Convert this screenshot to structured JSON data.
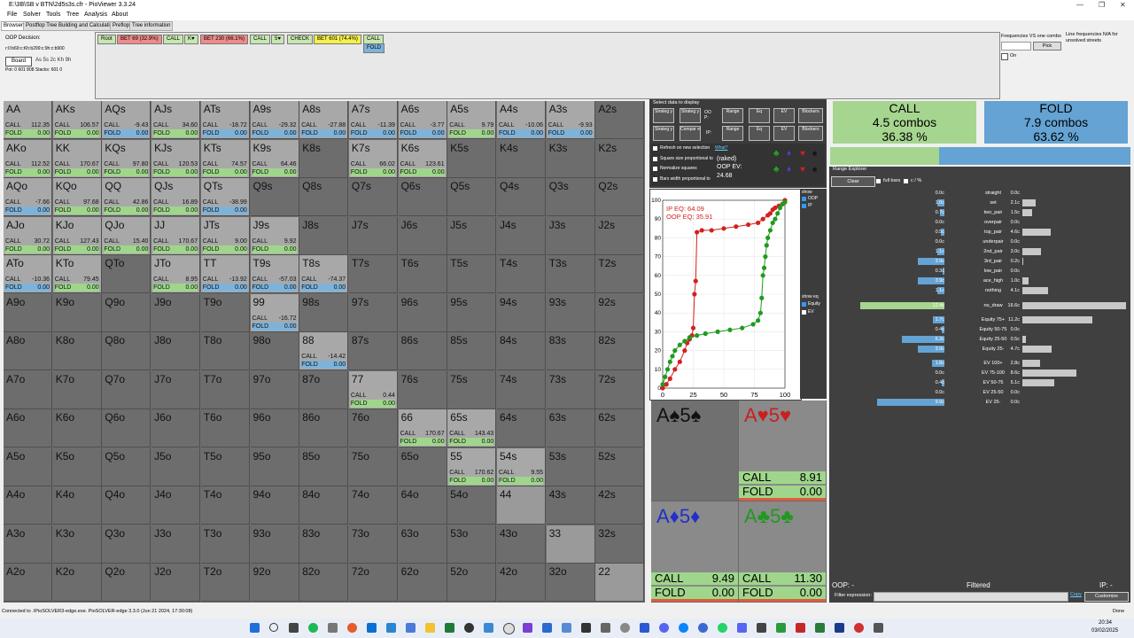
{
  "window": {
    "title": "E:\\3B\\SB v BTN\\2d5s3s.cfr - PioViewer 3.3.24",
    "controls": [
      "—",
      "❐",
      "✕"
    ]
  },
  "menu": [
    "File",
    "Solver",
    "Tools",
    "Tree",
    "Analysis",
    "About"
  ],
  "tabs": [
    "Browser",
    "Postflop Tree Building and Calculations",
    "Preflop",
    "Tree information"
  ],
  "oop_panel": {
    "title": "OOP Decision:",
    "path": "r:0:b69:c:Kh:b299:c:9h:c:b900",
    "board_btn": "Board",
    "board_cards": "As 5s 2c Kh 9h",
    "pot": "Pot: 0 601 808 Stacks: 601 0"
  },
  "tree_nodes": [
    {
      "label": "Root",
      "color": "#c7e7b0"
    },
    {
      "label": "BET 69 (32.9%)",
      "color": "#f08a8a"
    },
    {
      "label": "CALL",
      "color": "#c7e7b0"
    },
    {
      "label": "K♥",
      "color": "#c7e7b0"
    },
    {
      "label": "BET 230 (66.1%)",
      "color": "#f08a8a"
    },
    {
      "label": "CALL",
      "color": "#c7e7b0"
    },
    {
      "label": "5♥",
      "color": "#c7e7b0"
    },
    {
      "label": "CHECK",
      "color": "#c7e7b0"
    },
    {
      "label": "BET 601 (74.4%)",
      "color": "#f5f04a"
    },
    {
      "label": "CALL",
      "color": "#c7e7b0"
    }
  ],
  "tree_fold": "FOLD",
  "freq_panel": {
    "label": "Frequencies VS one combo",
    "pick": "Pick",
    "on": "On",
    "line_freq": "Line frequencies N/A for unsolved streets"
  },
  "grid": [
    [
      "AA",
      "AKs",
      "AQs",
      "AJs",
      "ATs",
      "A9s",
      "A8s",
      "A7s",
      "A6s",
      "A5s",
      "A4s",
      "A3s",
      "A2s"
    ],
    [
      "AKo",
      "KK",
      "KQs",
      "KJs",
      "KTs",
      "K9s",
      "K8s",
      "K7s",
      "K6s",
      "K5s",
      "K4s",
      "K3s",
      "K2s"
    ],
    [
      "AQo",
      "KQo",
      "QQ",
      "QJs",
      "QTs",
      "Q9s",
      "Q8s",
      "Q7s",
      "Q6s",
      "Q5s",
      "Q4s",
      "Q3s",
      "Q2s"
    ],
    [
      "AJo",
      "KJo",
      "QJo",
      "JJ",
      "JTs",
      "J9s",
      "J8s",
      "J7s",
      "J6s",
      "J5s",
      "J4s",
      "J3s",
      "J2s"
    ],
    [
      "ATo",
      "KTo",
      "QTo",
      "JTo",
      "TT",
      "T9s",
      "T8s",
      "T7s",
      "T6s",
      "T5s",
      "T4s",
      "T3s",
      "T2s"
    ],
    [
      "A9o",
      "K9o",
      "Q9o",
      "J9o",
      "T9o",
      "99",
      "98s",
      "97s",
      "96s",
      "95s",
      "94s",
      "93s",
      "92s"
    ],
    [
      "A8o",
      "K8o",
      "Q8o",
      "J8o",
      "T8o",
      "98o",
      "88",
      "87s",
      "86s",
      "85s",
      "84s",
      "83s",
      "82s"
    ],
    [
      "A7o",
      "K7o",
      "Q7o",
      "J7o",
      "T7o",
      "97o",
      "87o",
      "77",
      "76s",
      "75s",
      "74s",
      "73s",
      "72s"
    ],
    [
      "A6o",
      "K6o",
      "Q6o",
      "J6o",
      "T6o",
      "96o",
      "86o",
      "76o",
      "66",
      "65s",
      "64s",
      "63s",
      "62s"
    ],
    [
      "A5o",
      "K5o",
      "Q5o",
      "J5o",
      "T5o",
      "95o",
      "85o",
      "75o",
      "65o",
      "55",
      "54s",
      "53s",
      "52s"
    ],
    [
      "A4o",
      "K4o",
      "Q4o",
      "J4o",
      "T4o",
      "94o",
      "84o",
      "74o",
      "64o",
      "54o",
      "44",
      "43s",
      "42s"
    ],
    [
      "A3o",
      "K3o",
      "Q3o",
      "J3o",
      "T3o",
      "93o",
      "83o",
      "73o",
      "63o",
      "53o",
      "43o",
      "33",
      "32s"
    ],
    [
      "A2o",
      "K2o",
      "Q2o",
      "J2o",
      "T2o",
      "92o",
      "82o",
      "72o",
      "62o",
      "52o",
      "42o",
      "32o",
      "22"
    ]
  ],
  "strategies": {
    "AA": {
      "call": "112.35",
      "fold": "0.00"
    },
    "AKs": {
      "call": "106.57",
      "fold": "0.00"
    },
    "AQs": {
      "call": "-9.43",
      "fold": "0.00"
    },
    "AJs": {
      "call": "34.60",
      "fold": "0.00"
    },
    "ATs": {
      "call": "-18.72",
      "fold": "0.00"
    },
    "A9s": {
      "call": "-29.32",
      "fold": "0.00"
    },
    "A8s": {
      "call": "-27.88",
      "fold": "0.00"
    },
    "A7s": {
      "call": "-11.39",
      "fold": "0.00"
    },
    "A6s": {
      "call": "-3.77",
      "fold": "0.00"
    },
    "A5s": {
      "call": "9.79",
      "fold": "0.00"
    },
    "A4s": {
      "call": "-10.06",
      "fold": "0.00"
    },
    "A3s": {
      "call": "-9.93",
      "fold": "0.00"
    },
    "AKo": {
      "call": "112.52",
      "fold": "0.00"
    },
    "KK": {
      "call": "170.67",
      "fold": "0.00"
    },
    "KQs": {
      "call": "97.80",
      "fold": "0.00"
    },
    "KJs": {
      "call": "120.53",
      "fold": "0.00"
    },
    "KTs": {
      "call": "74.57",
      "fold": "0.00"
    },
    "K9s": {
      "call": "64.46",
      "fold": "0.00"
    },
    "K7s": {
      "call": "66.02",
      "fold": "0.00"
    },
    "K6s": {
      "call": "123.61",
      "fold": "0.00"
    },
    "AQo": {
      "call": "-7.66",
      "fold": "0.00"
    },
    "KQo": {
      "call": "97.68",
      "fold": "0.00"
    },
    "QQ": {
      "call": "42.86",
      "fold": "0.00"
    },
    "QJs": {
      "call": "16.89",
      "fold": "0.00"
    },
    "QTs": {
      "call": "-38.99",
      "fold": "0.00"
    },
    "AJo": {
      "call": "30.72",
      "fold": "0.00"
    },
    "KJo": {
      "call": "127.43",
      "fold": "0.00"
    },
    "QJo": {
      "call": "15.40",
      "fold": "0.00"
    },
    "JJ": {
      "call": "170.67",
      "fold": "0.00"
    },
    "JTs": {
      "call": "9.00",
      "fold": "0.00"
    },
    "J9s": {
      "call": "9.92",
      "fold": "0.00"
    },
    "ATo": {
      "call": "-10.36",
      "fold": "0.00"
    },
    "KTo": {
      "call": "79.45",
      "fold": "0.00"
    },
    "JTo": {
      "call": "8.95",
      "fold": "0.00"
    },
    "TT": {
      "call": "-13.92",
      "fold": "0.00"
    },
    "T9s": {
      "call": "-57.03",
      "fold": "0.00"
    },
    "T8s": {
      "call": "-74.37",
      "fold": "0.00"
    },
    "99": {
      "call": "-16.72",
      "fold": "0.00"
    },
    "88": {
      "call": "-14.42",
      "fold": "0.00"
    },
    "77": {
      "call": "0.44",
      "fold": "0.00"
    },
    "66": {
      "call": "170.67",
      "fold": "0.00"
    },
    "65s": {
      "call": "143.43",
      "fold": "0.00"
    },
    "55": {
      "call": "170.62",
      "fold": "0.00"
    },
    "54s": {
      "call": "9.55",
      "fold": "0.00"
    }
  },
  "call_fold_text": {
    "call": "CALL",
    "fold": "FOLD"
  },
  "data_panel": {
    "title": "Select data to display",
    "oop_buttons": [
      "Strateg y",
      "Strateg y",
      "Range",
      "Eq",
      "EV",
      "Blockers"
    ],
    "ip_buttons": [
      "Strateg y",
      "Compar e",
      "Range",
      "Eq",
      "EV",
      "Blockers"
    ],
    "oop_label": "OO P:",
    "ip_label": "IP:",
    "checks": [
      "Refresh on new selection",
      "Square size proportional to",
      "Normalize squares",
      "Bars width proportional to"
    ],
    "what": "What?",
    "raked": "(raked)",
    "oop_ev_label": "OOP EV:",
    "oop_ev_value": "24.68"
  },
  "chart_data": {
    "type": "line",
    "annotations": {
      "ip": "IP EQ: 64.09",
      "oop": "OOP EQ: 35.91"
    },
    "xlim": [
      0,
      100
    ],
    "ylim": [
      0,
      100
    ],
    "x_ticks": [
      0,
      25,
      50,
      75,
      100
    ],
    "y_ticks": [
      0,
      10,
      20,
      30,
      40,
      50,
      60,
      70,
      80,
      90,
      100
    ],
    "series": [
      {
        "color": "#d42020",
        "points": [
          [
            0,
            0
          ],
          [
            3,
            2
          ],
          [
            6,
            5
          ],
          [
            10,
            10
          ],
          [
            14,
            14
          ],
          [
            18,
            20
          ],
          [
            20,
            24
          ],
          [
            22,
            26
          ],
          [
            24,
            28
          ],
          [
            25,
            32
          ],
          [
            26,
            50
          ],
          [
            27,
            57
          ],
          [
            28,
            83
          ],
          [
            32,
            84
          ],
          [
            40,
            84
          ],
          [
            50,
            85
          ],
          [
            60,
            86
          ],
          [
            70,
            87
          ],
          [
            78,
            88
          ],
          [
            82,
            90
          ],
          [
            86,
            92
          ],
          [
            88,
            93
          ],
          [
            90,
            95
          ],
          [
            92,
            96
          ],
          [
            95,
            97
          ],
          [
            98,
            98
          ],
          [
            100,
            100
          ]
        ]
      },
      {
        "color": "#1f9a1f",
        "points": [
          [
            0,
            2
          ],
          [
            2,
            6
          ],
          [
            4,
            10
          ],
          [
            6,
            14
          ],
          [
            8,
            17
          ],
          [
            10,
            20
          ],
          [
            14,
            23
          ],
          [
            18,
            25
          ],
          [
            22,
            27
          ],
          [
            28,
            28
          ],
          [
            35,
            29
          ],
          [
            45,
            30
          ],
          [
            55,
            31
          ],
          [
            65,
            32
          ],
          [
            74,
            34
          ],
          [
            78,
            36
          ],
          [
            80,
            40
          ],
          [
            81,
            48
          ],
          [
            82,
            60
          ],
          [
            83,
            64
          ],
          [
            84,
            70
          ],
          [
            85,
            76
          ],
          [
            86,
            80
          ],
          [
            88,
            84
          ],
          [
            90,
            88
          ],
          [
            92,
            90
          ],
          [
            94,
            93
          ],
          [
            96,
            96
          ],
          [
            98,
            98
          ],
          [
            100,
            99
          ]
        ]
      }
    ]
  },
  "chart_side": {
    "show": "show",
    "oop": "OOP",
    "ip": "IP",
    "show_eq": "show eq",
    "equity": "Equity",
    "ev": "EV"
  },
  "suits": [
    {
      "cards": "A♠5♠",
      "color": "#111111",
      "call": "",
      "fold": ""
    },
    {
      "cards": "A♥5♥",
      "color": "#c82020",
      "call": "8.91",
      "fold": "0.00"
    },
    {
      "cards": "A♦5♦",
      "color": "#2030c8",
      "call": "9.49",
      "fold": "0.00"
    },
    {
      "cards": "A♣5♣",
      "color": "#1f9a1f",
      "call": "11.30",
      "fold": "0.00"
    }
  ],
  "summary": {
    "call": {
      "label": "CALL",
      "combos": "4.5 combos",
      "pct": "36.38 %"
    },
    "fold": {
      "label": "FOLD",
      "combos": "7.9 combos",
      "pct": "63.62 %"
    },
    "call_fraction": 0.3638
  },
  "range_explorer": {
    "title": "Range Explorer",
    "clear": "Clear",
    "full_bars": "full bars",
    "c_pct": "c / %",
    "rows": [
      {
        "name": "straight",
        "left": "0.0c",
        "right": "0.0c"
      },
      {
        "name": "set",
        "left": "1.0c",
        "right": "2.1c"
      },
      {
        "name": "two_pair",
        "left": "0.7c",
        "right": "1.5c"
      },
      {
        "name": "overpair",
        "left": "0.0c",
        "right": "0.0c"
      },
      {
        "name": "top_pair",
        "left": "0.5c",
        "right": "4.6c"
      },
      {
        "name": "underpair",
        "left": "0.0c",
        "right": "0.0c"
      },
      {
        "name": "2nd_pair",
        "left": "1.1c",
        "right": "3.0c"
      },
      {
        "name": "3rd_pair",
        "left": "3.9c",
        "right": "0.2c"
      },
      {
        "name": "low_pair",
        "left": "0.3c",
        "right": "0.0c"
      },
      {
        "name": "ace_high",
        "left": "3.9c",
        "right": "1.0c"
      },
      {
        "name": "nothing",
        "left": "1.1c",
        "right": "4.1c"
      },
      {
        "name": "no_draw",
        "left": "12.4c",
        "right": "16.6c"
      },
      {
        "name": "Equity 75+",
        "left": "1.7c",
        "right": "11.2c"
      },
      {
        "name": "Equity 50-75",
        "left": "0.4c",
        "right": "0.0c"
      },
      {
        "name": "Equity 25-50",
        "left": "6.3c",
        "right": "0.5c"
      },
      {
        "name": "Equity 25-",
        "left": "3.9c",
        "right": "4.7c"
      },
      {
        "name": "EV 100+",
        "left": "1.8c",
        "right": "2.8c"
      },
      {
        "name": "EV 75-100",
        "left": "0.0c",
        "right": "8.6c"
      },
      {
        "name": "EV 50-75",
        "left": "0.4c",
        "right": "5.1c"
      },
      {
        "name": "EV 25-50",
        "left": "0.0c",
        "right": "0.0c"
      },
      {
        "name": "EV 25-",
        "left": "9.9c",
        "right": "0.0c"
      }
    ],
    "oop_label": "OOP: -",
    "filtered": "Filtered",
    "ip_label": "IP: -",
    "filter_label": "Filter expression:",
    "copy": "Copy",
    "customize": "Customize"
  },
  "status": {
    "left": "Connected to .\\PioSOLVER3-edge.exe. PioSOLVER-edge 3.3.0 (Jun 21 2024, 17:30:08)",
    "right": "Done"
  },
  "taskbar": {
    "time": "20:34",
    "date": "03/02/2025"
  }
}
